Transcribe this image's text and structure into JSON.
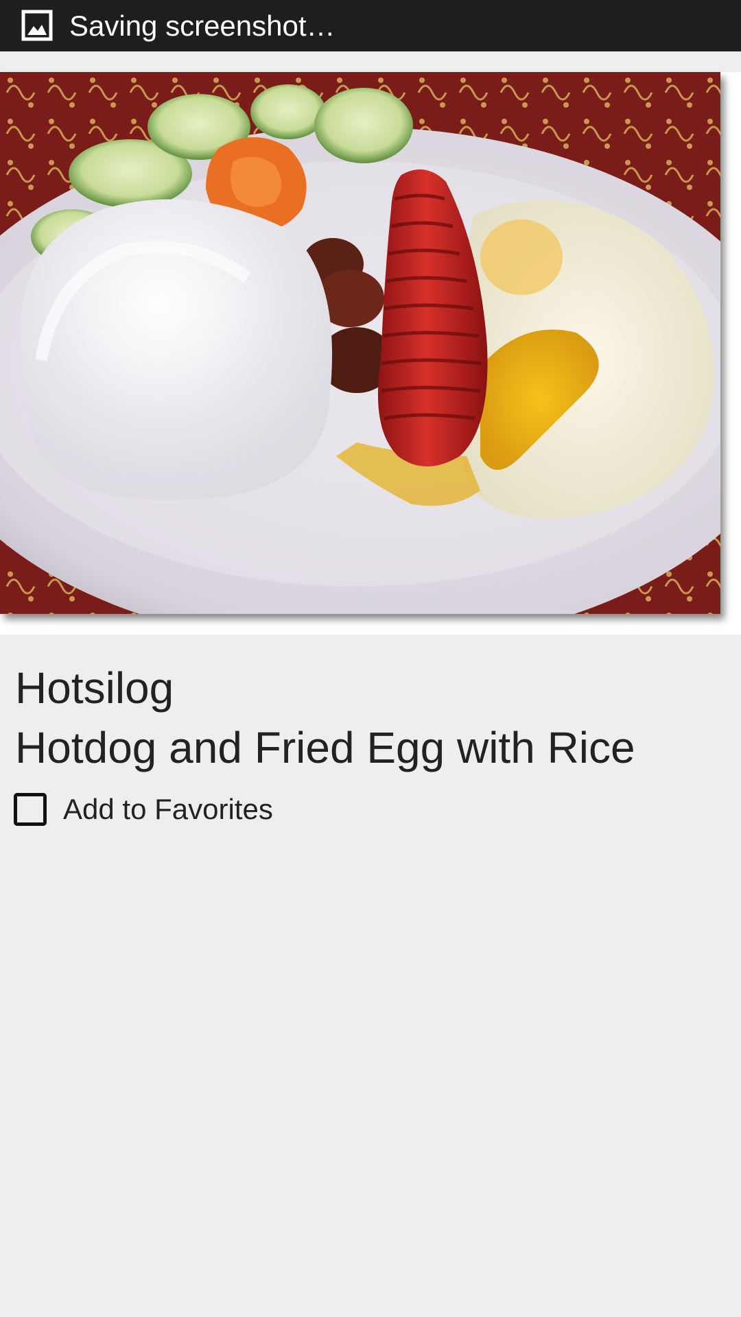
{
  "status_bar": {
    "notification_icon": "image-icon",
    "notification_text": "Saving screenshot…"
  },
  "dish": {
    "photo_icon": "food-photo",
    "name": "Hotsilog",
    "description": "Hotdog and Fried Egg with Rice"
  },
  "favorite": {
    "label": "Add to Favorites",
    "checked": false
  },
  "colors": {
    "status_bar_bg": "#1e1e1e",
    "page_bg": "#eeeeee",
    "text": "#222222"
  }
}
